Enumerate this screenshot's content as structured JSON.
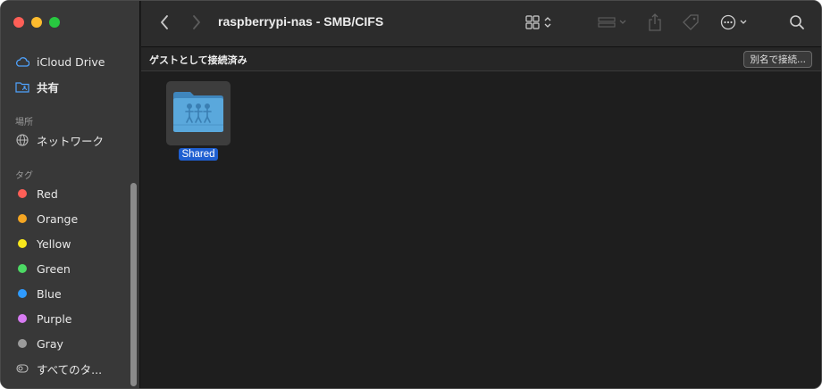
{
  "window": {
    "title": "raspberrypi-nas - SMB/CIFS"
  },
  "sidebar": {
    "favorites": [
      {
        "label": "iCloud Drive",
        "icon": "cloud-icon"
      },
      {
        "label": "共有",
        "icon": "shared-folder-icon"
      }
    ],
    "locations_header": "場所",
    "locations": [
      {
        "label": "ネットワーク",
        "icon": "network-globe-icon"
      }
    ],
    "tags_header": "タグ",
    "tags": [
      {
        "label": "Red",
        "color": "#ff5f57"
      },
      {
        "label": "Orange",
        "color": "#f5a623"
      },
      {
        "label": "Yellow",
        "color": "#f8e71c"
      },
      {
        "label": "Green",
        "color": "#4cd964"
      },
      {
        "label": "Blue",
        "color": "#2f9bff"
      },
      {
        "label": "Purple",
        "color": "#d77bf2"
      },
      {
        "label": "Gray",
        "color": "#9b9b9b"
      }
    ],
    "all_tags": "すべてのタ..."
  },
  "toolbar": {
    "back_icon": "chevron-left-icon",
    "forward_icon": "chevron-right-icon",
    "view_icon": "grid-view-icon",
    "group_icon": "group-by-icon",
    "share_icon": "share-icon",
    "tag_icon": "tag-icon",
    "more_icon": "ellipsis-circle-icon",
    "search_icon": "search-icon"
  },
  "pathbar": {
    "status": "ゲストとして接続済み",
    "connect_label": "別名で接続..."
  },
  "files": [
    {
      "name": "Shared",
      "icon": "shared-network-folder-icon",
      "selected": true
    }
  ],
  "colors": {
    "selection": "#1f5fd1",
    "folder": "#4f9fd6"
  }
}
